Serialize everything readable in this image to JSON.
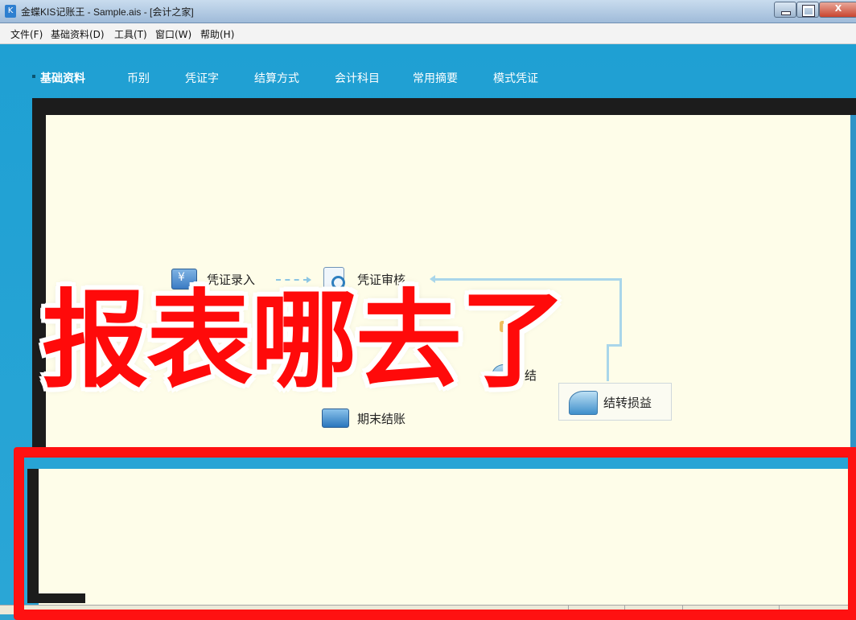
{
  "window": {
    "title": "金蝶KIS记账王 - Sample.ais - [会计之家]",
    "controls": {
      "minimize": "",
      "maximize": "",
      "close": "X"
    }
  },
  "menubar": {
    "items": [
      "文件(F)",
      "基础资料(D)",
      "工具(T)",
      "窗口(W)",
      "帮助(H)"
    ]
  },
  "nav": {
    "tabs": [
      "基础资料",
      "币别",
      "凭证字",
      "结算方式",
      "会计科目",
      "常用摘要",
      "模式凭证"
    ],
    "active_index": 0
  },
  "workflow": {
    "voucher_entry": "凭证录入",
    "voucher_review": "凭证审核",
    "transfer_partial": "结",
    "period_close_partial": "期末结账",
    "profit_loss_transfer": "结转损益"
  },
  "overlay": {
    "text": "报表哪去了",
    "color": "#ff0a0a"
  },
  "colors": {
    "accent_blue": "#1fa0d3",
    "panel_bg": "#fefde9",
    "highlight_red": "#ff1111"
  }
}
